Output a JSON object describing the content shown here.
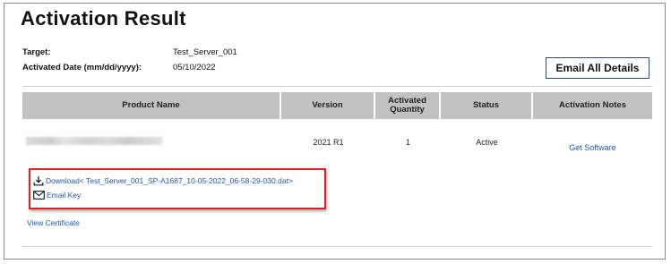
{
  "page": {
    "title": "Activation Result"
  },
  "meta": {
    "target_label": "Target:",
    "target_value": "Test_Server_001",
    "date_label": "Activated Date (mm/dd/yyyy):",
    "date_value": "05/10/2022"
  },
  "actions": {
    "email_all_label": "Email All Details"
  },
  "table": {
    "columns": [
      "Product Name",
      "Version",
      "Activated Quantity",
      "Status",
      "Activation Notes"
    ],
    "rows": [
      {
        "product_name": "",
        "version": "2021 R1",
        "quantity": "1",
        "status": "Active",
        "notes_link": "Get Software"
      }
    ]
  },
  "downloads": {
    "download_link": "Download< Test_Server_001_SP-A1687_10-05-2022_06-58-29-030.dat>",
    "email_key_link": "Email Key"
  },
  "certificate": {
    "view_link": "View Certificate"
  },
  "colors": {
    "link": "#1a56b8",
    "header_bg": "#c2c2c2",
    "highlight_border": "#e02020",
    "button_border": "#1f4f8c"
  },
  "icons": {
    "download": "download-icon",
    "email": "envelope-icon"
  }
}
